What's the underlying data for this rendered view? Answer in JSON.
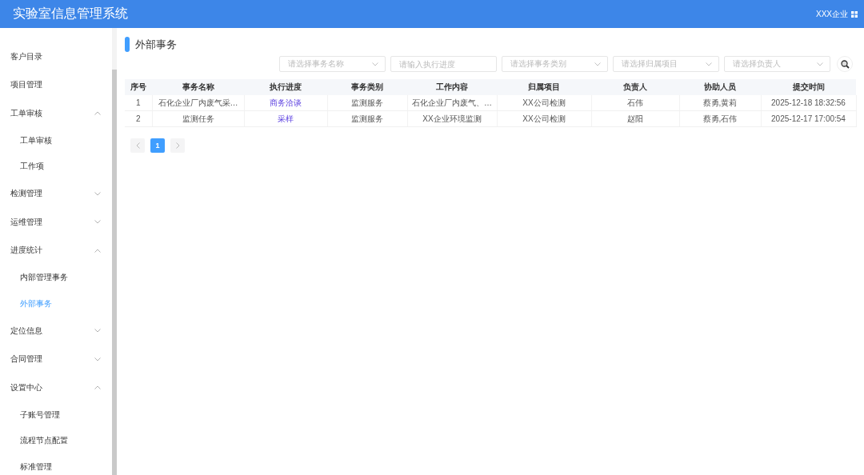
{
  "header": {
    "title": "实验室信息管理系统",
    "company": "XXX企业"
  },
  "sidebar": {
    "items": [
      {
        "label": "客户目录",
        "selected": false
      },
      {
        "label": "项目管理",
        "selected": false
      },
      {
        "label": "工单审核",
        "selected": false,
        "expanded": true,
        "children": [
          {
            "label": "工单审核",
            "selected": false
          },
          {
            "label": "工作项",
            "selected": false
          }
        ]
      },
      {
        "label": "检测管理",
        "selected": false,
        "expanded": false
      },
      {
        "label": "运维管理",
        "selected": false,
        "expanded": false
      },
      {
        "label": "进度统计",
        "selected": false,
        "expanded": true,
        "children": [
          {
            "label": "内部管理事务",
            "selected": false
          },
          {
            "label": "外部事务",
            "selected": true
          }
        ]
      },
      {
        "label": "定位信息",
        "selected": false,
        "expanded": false
      },
      {
        "label": "合同管理",
        "selected": false,
        "expanded": false
      },
      {
        "label": "设置中心",
        "selected": false,
        "expanded": true,
        "children": [
          {
            "label": "子账号管理",
            "selected": false
          },
          {
            "label": "流程节点配置",
            "selected": false
          },
          {
            "label": "标准管理",
            "selected": false
          }
        ]
      }
    ]
  },
  "page_title": "外部事务",
  "filters": [
    {
      "kind": "select",
      "placeholder": "请选择事务名称"
    },
    {
      "kind": "input",
      "placeholder": "请输入执行进度"
    },
    {
      "kind": "select",
      "placeholder": "请选择事务类别"
    },
    {
      "kind": "select",
      "placeholder": "请选择归属项目"
    },
    {
      "kind": "select",
      "placeholder": "请选择负责人"
    }
  ],
  "table": {
    "columns": [
      "序号",
      "事务名称",
      "执行进度",
      "事务类别",
      "工作内容",
      "归属项目",
      "负责人",
      "协助人员",
      "提交时间"
    ],
    "rows": [
      [
        "1",
        "石化企业厂内废气采…",
        "商务洽谈",
        "监测服务",
        "石化企业厂内废气、…",
        "XX公司检测",
        "石伟",
        "蔡勇,黄莉",
        "2025-12-18 18:32:56"
      ],
      [
        "2",
        "监测任务",
        "采样",
        "监测服务",
        "XX企业环境监测",
        "XX公司检测",
        "赵阳",
        "蔡勇,石伟",
        "2025-12-17 17:00:54"
      ]
    ]
  },
  "pagination": {
    "pages": [
      {
        "label": "1",
        "selected": true
      }
    ]
  }
}
